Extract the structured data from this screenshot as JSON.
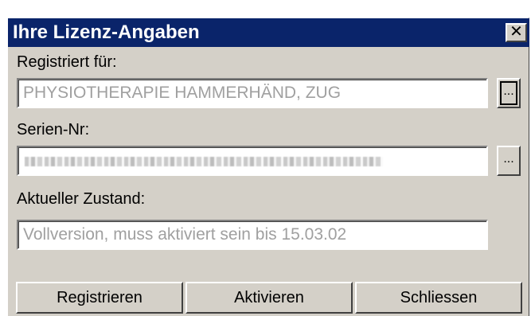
{
  "dialog": {
    "title": "Ihre Lizenz-Angaben",
    "close_glyph": "✕",
    "registered_for": {
      "label": "Registriert für:",
      "value": "PHYSIOTHERAPIE HAMMERHÄND, ZUG",
      "browse_label": "..."
    },
    "serial": {
      "label": "Serien-Nr:",
      "browse_label": "..."
    },
    "status": {
      "label": "Aktueller Zustand:",
      "value": "Vollversion, muss aktiviert sein bis 15.03.02"
    },
    "buttons": {
      "register": "Registrieren",
      "activate": "Aktivieren",
      "close": "Schliessen"
    }
  }
}
